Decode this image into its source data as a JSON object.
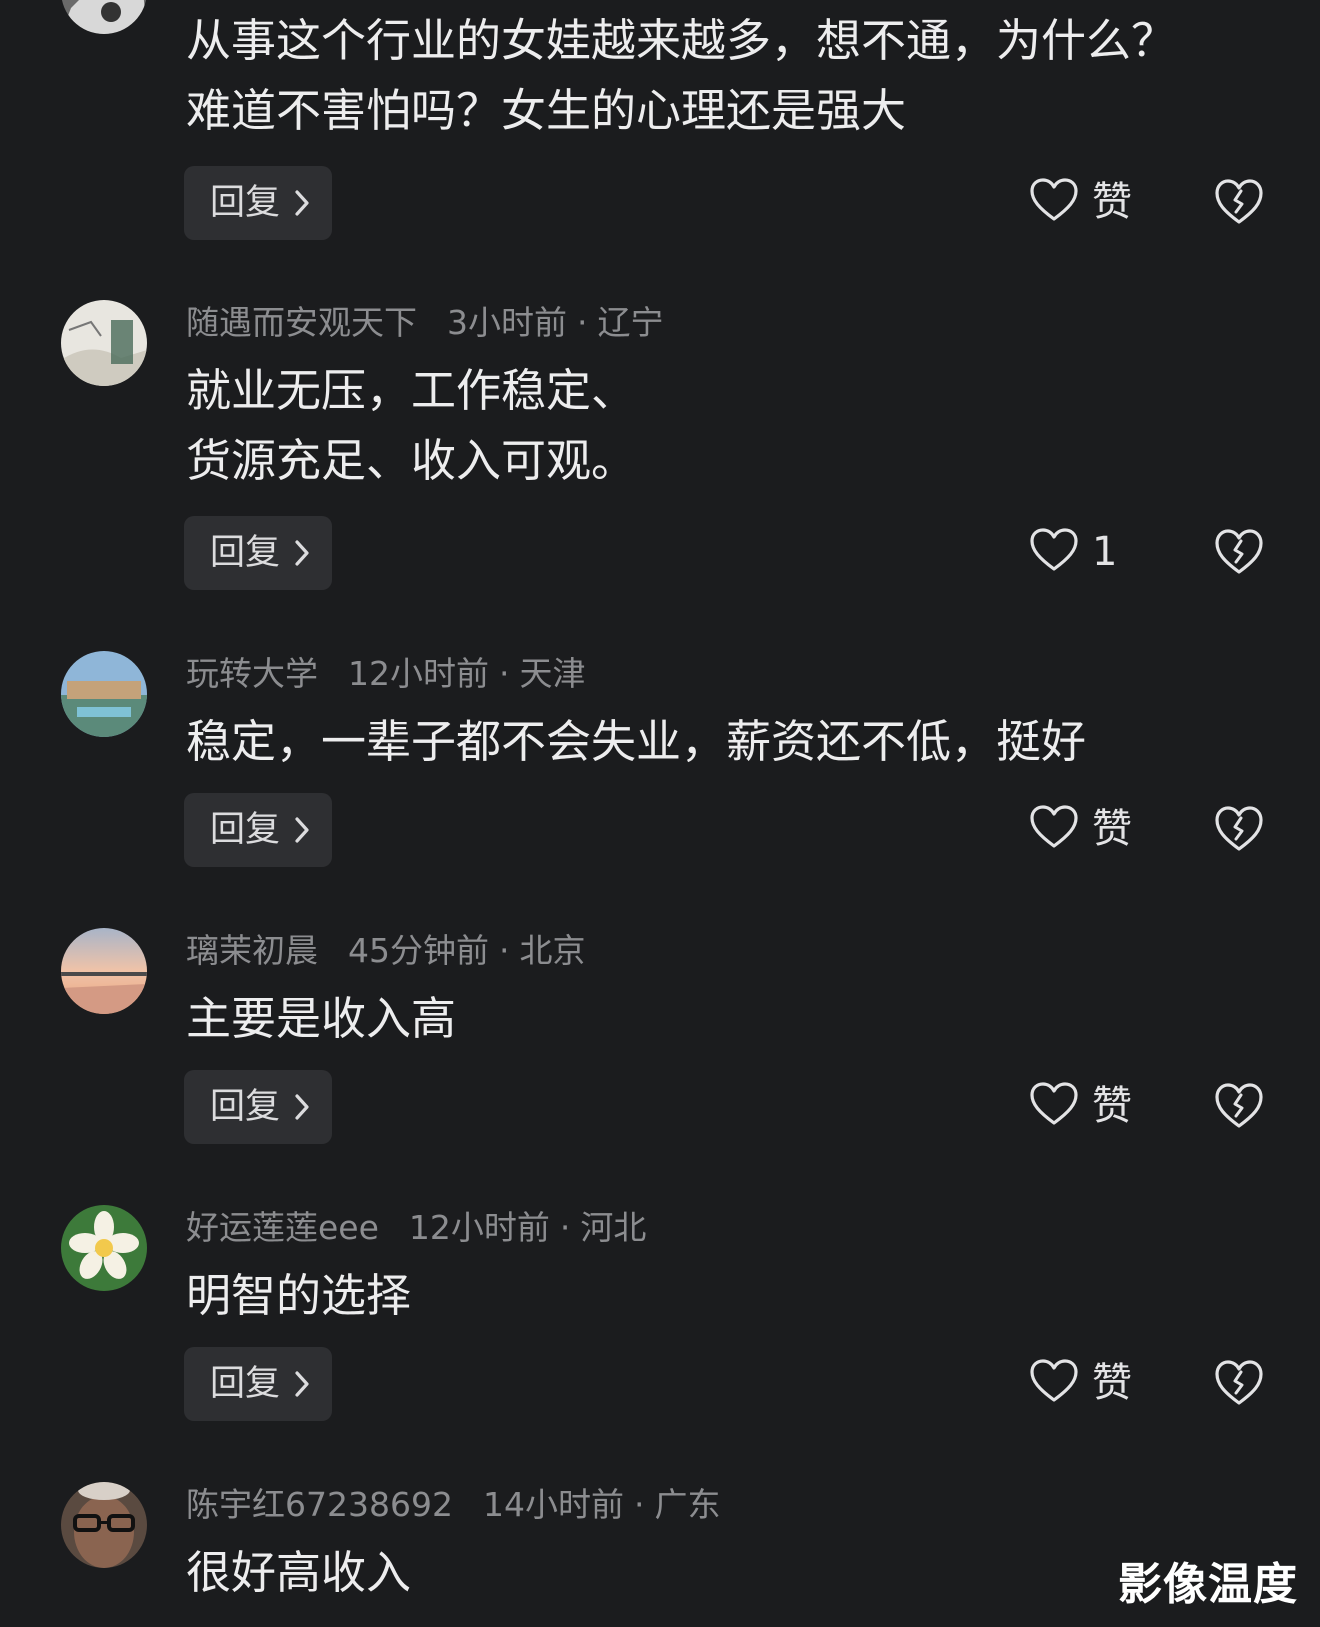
{
  "comments": [
    {
      "user": "",
      "time": "",
      "location": "",
      "lines": [
        "从事这个行业的女娃越来越多，想不通，为什么？",
        "难道不害怕吗？女生的心理还是强大"
      ],
      "reply_label": "回复",
      "like_label": "赞"
    },
    {
      "user": "随遇而安观天下",
      "time": "3小时前",
      "location": "辽宁",
      "lines": [
        "就业无压，工作稳定、",
        "货源充足、收入可观。"
      ],
      "reply_label": "回复",
      "like_label": "1"
    },
    {
      "user": "玩转大学",
      "time": "12小时前",
      "location": "天津",
      "lines": [
        "稳定，一辈子都不会失业，薪资还不低，挺好"
      ],
      "reply_label": "回复",
      "like_label": "赞"
    },
    {
      "user": "璃茉初晨",
      "time": "45分钟前",
      "location": "北京",
      "lines": [
        "主要是收入高"
      ],
      "reply_label": "回复",
      "like_label": "赞"
    },
    {
      "user": "好运莲莲eee",
      "time": "12小时前",
      "location": "河北",
      "lines": [
        "明智的选择"
      ],
      "reply_label": "回复",
      "like_label": "赞"
    },
    {
      "user": "陈宇红67238692",
      "time": "14小时前",
      "location": "广东",
      "lines": [
        "很好高收入"
      ],
      "reply_label": "",
      "like_label": ""
    }
  ],
  "meta_separator": "·",
  "watermark": "影像温度",
  "icons": {
    "like": "heart-outline-icon",
    "dislike": "broken-heart-icon",
    "reply_chevron": "chevron-right-icon"
  },
  "colors": {
    "background": "#1b1c1e",
    "button_bg": "#2e2f32",
    "meta_text": "#8c8d90",
    "body_text": "#ededee"
  }
}
